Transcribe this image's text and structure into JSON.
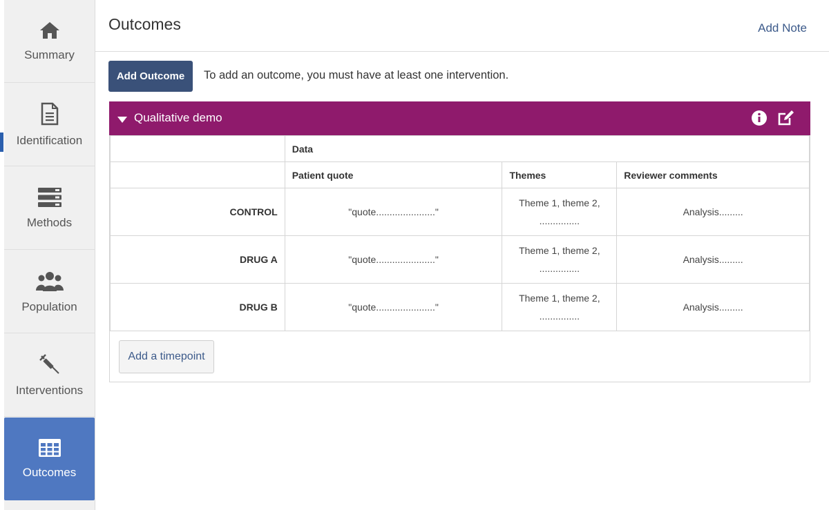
{
  "sidebar": {
    "items": [
      {
        "label": "Summary",
        "icon": "home-icon"
      },
      {
        "label": "Identification",
        "icon": "document-icon"
      },
      {
        "label": "Methods",
        "icon": "server-icon"
      },
      {
        "label": "Population",
        "icon": "users-icon"
      },
      {
        "label": "Interventions",
        "icon": "syringe-icon"
      },
      {
        "label": "Outcomes",
        "icon": "table-icon",
        "active": true
      }
    ]
  },
  "header": {
    "title": "Outcomes",
    "add_note": "Add Note"
  },
  "toolbar": {
    "add_outcome": "Add Outcome",
    "hint": "To add an outcome, you must have at least one intervention."
  },
  "outcome": {
    "title": "Qualitative demo",
    "color": "#8f1a6c",
    "group_header": "Data",
    "columns": [
      "Patient quote",
      "Themes",
      "Reviewer comments"
    ],
    "rows": [
      {
        "label": "CONTROL",
        "quote": "\"quote......................\"",
        "themes_line1": "Theme 1, theme 2,",
        "themes_line2": "...............",
        "comment": "Analysis........."
      },
      {
        "label": "DRUG A",
        "quote": "\"quote......................\"",
        "themes_line1": "Theme 1, theme 2,",
        "themes_line2": "...............",
        "comment": "Analysis........."
      },
      {
        "label": "DRUG B",
        "quote": "\"quote......................\"",
        "themes_line1": "Theme 1, theme 2,",
        "themes_line2": "...............",
        "comment": "Analysis........."
      }
    ],
    "add_timepoint": "Add a timepoint"
  },
  "colors": {
    "sidebar_active": "#4f78c1",
    "primary_button": "#3a5179",
    "link": "#3c5a8a"
  }
}
